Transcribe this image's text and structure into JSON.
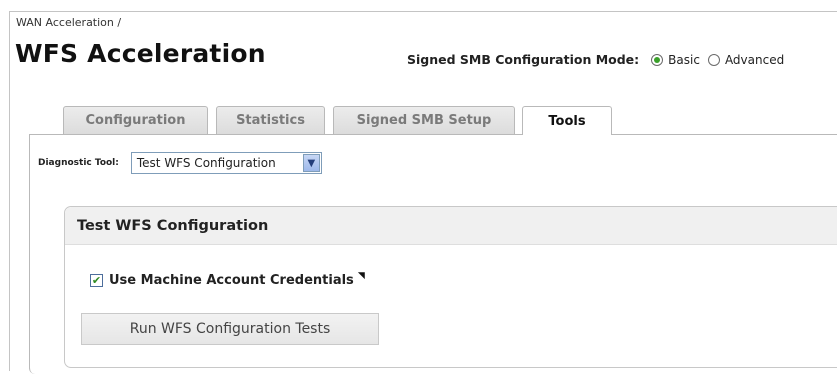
{
  "breadcrumb": "WAN Acceleration /",
  "page_title": "WFS Acceleration",
  "smb_mode": {
    "label": "Signed SMB Configuration Mode:",
    "options": [
      {
        "label": "Basic",
        "selected": true
      },
      {
        "label": "Advanced",
        "selected": false
      }
    ],
    "accent_color": "#3aa02a"
  },
  "tabs": [
    {
      "label": "Configuration",
      "active": false
    },
    {
      "label": "Statistics",
      "active": false
    },
    {
      "label": "Signed SMB Setup",
      "active": false
    },
    {
      "label": "Tools",
      "active": true
    }
  ],
  "diagnostic": {
    "label": "Diagnostic Tool:",
    "selected": "Test WFS Configuration"
  },
  "panel": {
    "title": "Test WFS Configuration",
    "checkbox_label": "Use Machine Account Credentials",
    "checkbox_checked": true,
    "run_button": "Run WFS Configuration Tests"
  }
}
